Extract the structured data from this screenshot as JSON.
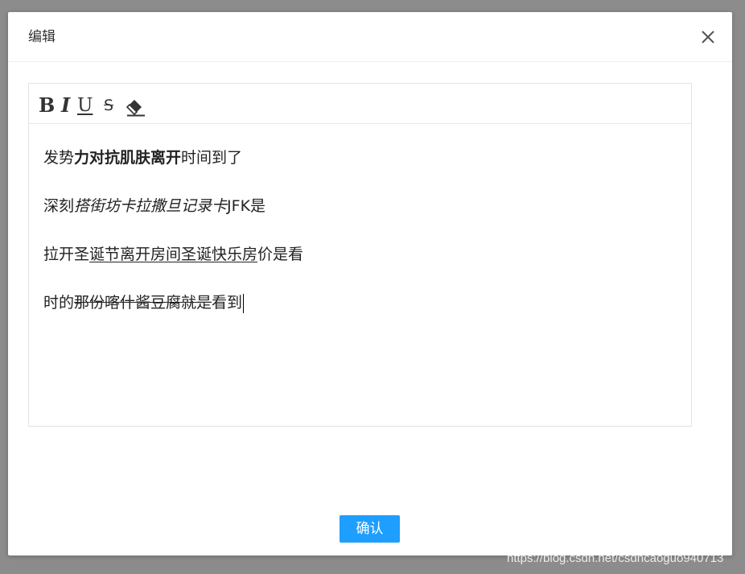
{
  "dialog": {
    "title": "编辑",
    "confirm_label": "确认"
  },
  "toolbar": {
    "bold_label": "B",
    "italic_label": "I",
    "underline_label": "U",
    "strike_label": "S",
    "tools": [
      "bold-icon",
      "italic-icon",
      "underline-icon",
      "strikethrough-icon",
      "eraser-icon"
    ]
  },
  "editor": {
    "paragraphs": [
      {
        "plain_before": "发势",
        "bold": "力对抗肌肤离开",
        "plain_after": "时间到了"
      },
      {
        "plain_before": "深刻",
        "italic": "搭街坊卡拉撒旦记录卡",
        "plain_after": "JFK是"
      },
      {
        "plain_before": "拉开圣",
        "underline": "诞节离开房间圣诞快乐房",
        "plain_after": "价是看"
      },
      {
        "plain_before": "时的",
        "strike": "那份喀什酱豆腐就是",
        "plain_after": "看到"
      }
    ]
  },
  "watermark": "https://blog.csdn.net/csdncaoguo940713",
  "colors": {
    "overlay": "#8c8c8c",
    "dialog_bg": "#ffffff",
    "confirm_bg": "#1e9fff",
    "text": "#222222"
  }
}
